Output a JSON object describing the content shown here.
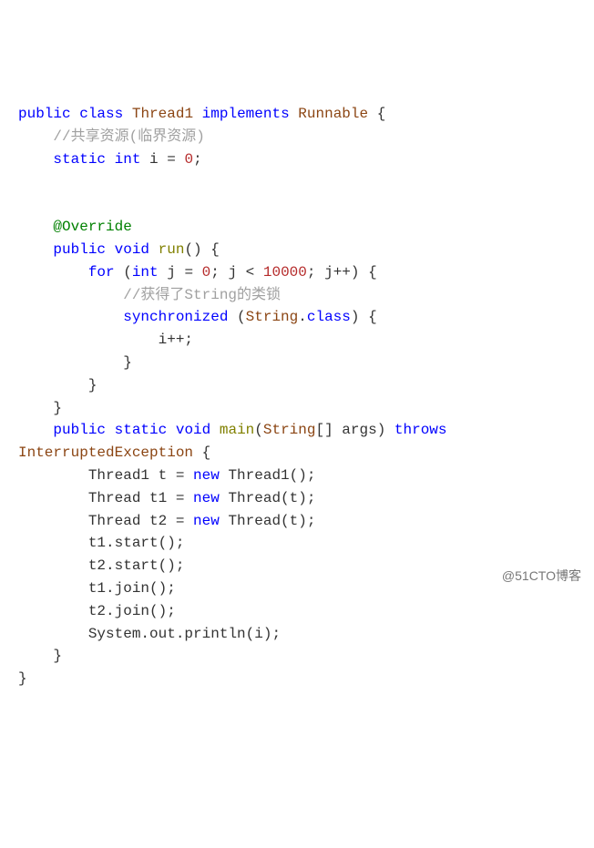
{
  "code": {
    "class_decl": {
      "kw_public": "public",
      "kw_class": "class",
      "class_name": "Thread1",
      "kw_implements": "implements",
      "interface": "Runnable",
      "brace_open": " {"
    },
    "comment_shared": "//共享资源(临界资源)",
    "field_decl": {
      "kw_static": "static",
      "kw_int": "int",
      "rest": " i = ",
      "zero": "0",
      "semi": ";"
    },
    "override": "@Override",
    "run_decl": {
      "kw_public": "public",
      "kw_void": "void",
      "name": "run",
      "parens": "() {"
    },
    "for_stmt": {
      "kw_for": "for",
      "open": " (",
      "kw_int": "int",
      "j_eq": " j = ",
      "zero": "0",
      "mid": "; j < ",
      "limit": "10000",
      "end": "; j++) {"
    },
    "comment_lock": "//获得了String的类锁",
    "sync_stmt": {
      "kw_sync": "synchronized",
      "open": " (",
      "string_cls": "String",
      "dot_class": ".",
      "kw_class": "class",
      "close": ") {"
    },
    "inc_stmt": "i++;",
    "brace_close": "}",
    "main_decl": {
      "kw_public": "public",
      "kw_static": "static",
      "kw_void": "void",
      "name": "main",
      "open": "(",
      "string_type": "String",
      "brackets": "[]",
      "args": " args)",
      "kw_throws": " throws"
    },
    "exception": "InterruptedException",
    "exc_brace": " {",
    "body": {
      "line1_a": "Thread1 t = ",
      "line1_new": "new",
      "line1_b": " Thread1();",
      "line2_a": "Thread t1 = ",
      "line2_new": "new",
      "line2_b": " Thread(t);",
      "line3_a": "Thread t2 = ",
      "line3_new": "new",
      "line3_b": " Thread(t);",
      "line4": "t1.start();",
      "line5": "t2.start();",
      "line6": "t1.join();",
      "line7": "t2.join();",
      "line8": "System.out.println(i);"
    }
  },
  "watermark": "@51CTO博客"
}
